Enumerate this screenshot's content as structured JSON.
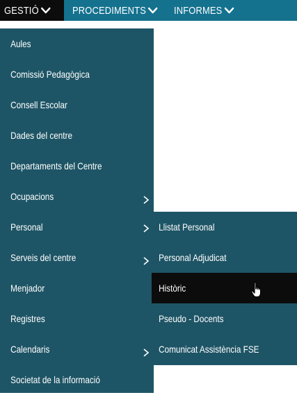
{
  "topnav": {
    "tabs": [
      {
        "label": "GESTIÓ"
      },
      {
        "label": "PROCEDIMENTS"
      },
      {
        "label": "INFORMES"
      }
    ]
  },
  "menu": {
    "items": [
      {
        "label": "Aules"
      },
      {
        "label": "Comissió Pedagògica"
      },
      {
        "label": "Consell Escolar"
      },
      {
        "label": "Dades del centre"
      },
      {
        "label": "Departaments del Centre"
      },
      {
        "label": "Ocupacions"
      },
      {
        "label": "Personal"
      },
      {
        "label": "Serveis del centre"
      },
      {
        "label": "Menjador"
      },
      {
        "label": "Registres"
      },
      {
        "label": "Calendaris"
      },
      {
        "label": "Societat de la informació"
      }
    ]
  },
  "submenu": {
    "items": [
      {
        "label": "Llistat Personal"
      },
      {
        "label": "Personal Adjudicat"
      },
      {
        "label": "Històric"
      },
      {
        "label": "Pseudo - Docents"
      },
      {
        "label": "Comunicat Assistència FSE"
      }
    ]
  },
  "colors": {
    "topbar": "#14728f",
    "menu": "#1e5566",
    "active": "#0c0c0c",
    "text": "#ffffff"
  },
  "icons": {
    "chevron": "chevron-down-icon",
    "submenu": "chevron-right-icon",
    "cursor": "hand-pointer-icon"
  }
}
